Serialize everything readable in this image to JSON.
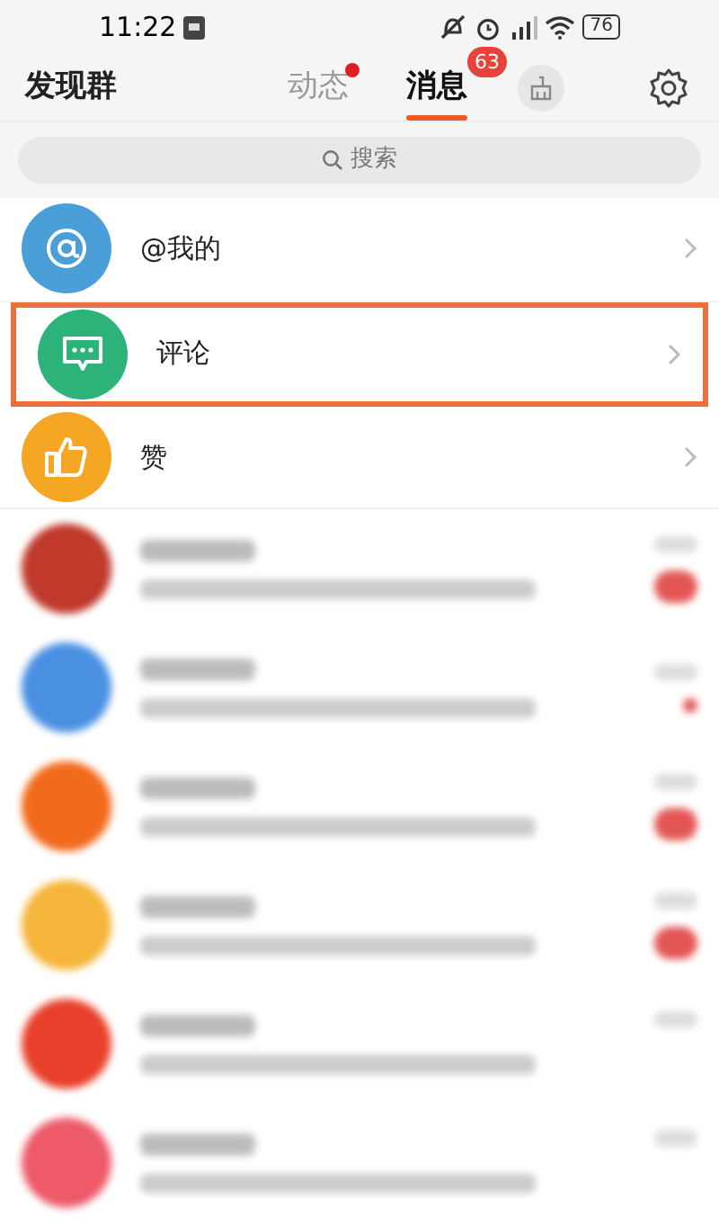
{
  "status_bar": {
    "time": "11:22",
    "battery": "76"
  },
  "header": {
    "left": "发现群",
    "tabs": [
      {
        "label": "动态",
        "selected": false,
        "dot": true
      },
      {
        "label": "消息",
        "selected": true,
        "badge": "63"
      }
    ]
  },
  "search": {
    "placeholder": "搜索"
  },
  "entries": [
    {
      "kind": "mention",
      "label": "@我的",
      "highlighted": false
    },
    {
      "kind": "comment",
      "label": "评论",
      "highlighted": true
    },
    {
      "kind": "like",
      "label": "赞",
      "highlighted": false
    }
  ],
  "blurred_rows": [
    {
      "color": "#c0392b",
      "kind": "pill"
    },
    {
      "color": "#4a90e2",
      "kind": "dot"
    },
    {
      "color": "#f26a1b",
      "kind": "pill"
    },
    {
      "color": "#f5b43a",
      "kind": "pill"
    },
    {
      "color": "#e8402a",
      "kind": "plain"
    },
    {
      "color": "#ee5a6a",
      "kind": "plain"
    }
  ]
}
